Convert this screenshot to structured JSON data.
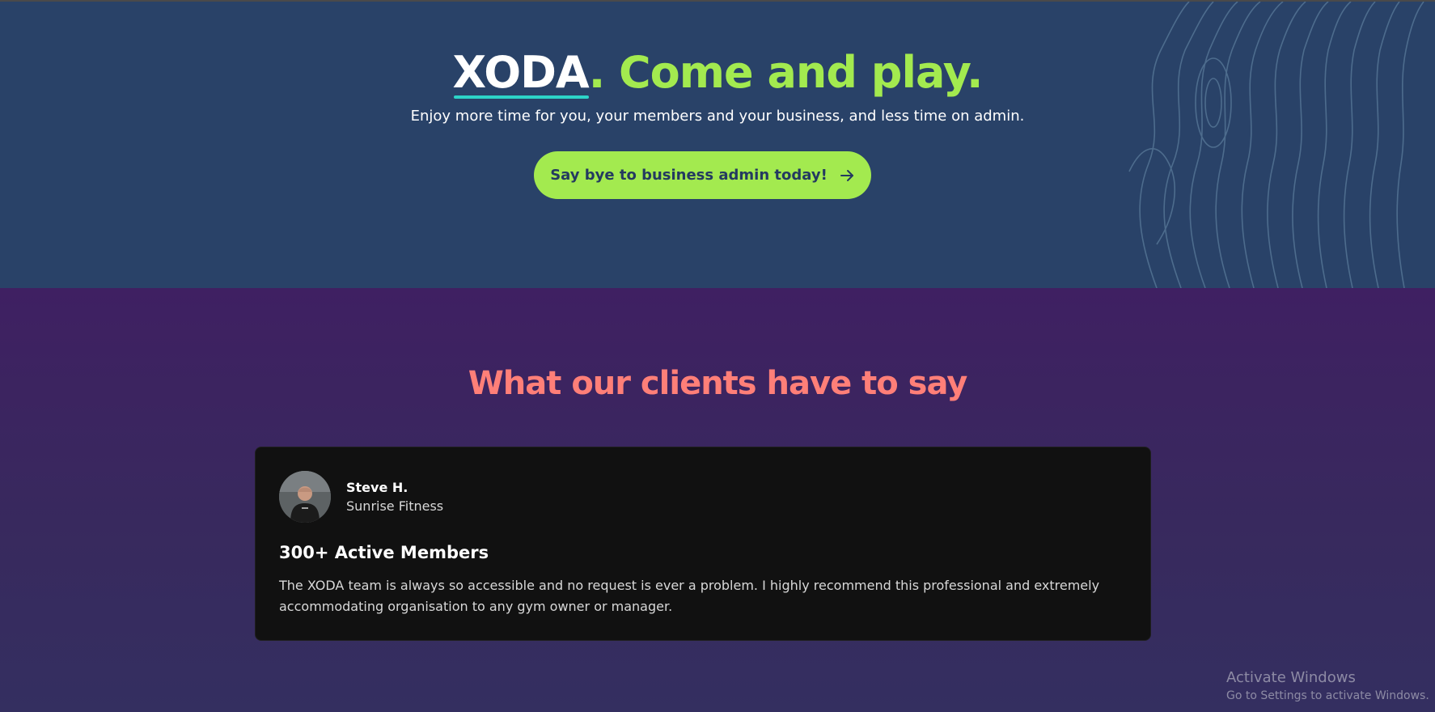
{
  "hero": {
    "brand": "XODA",
    "title_rest": ". Come and play.",
    "subtitle": "Enjoy more time for you, your members and your business, and less time on admin.",
    "cta_label": "Say bye to business admin today!",
    "cta_icon": "arrow-right-icon"
  },
  "testimonials": {
    "title": "What our clients have to say",
    "items": [
      {
        "name": "Steve H.",
        "company": "Sunrise Fitness",
        "heading": "300+ Active Members",
        "quote": "The XODA team is always so accessible and no request is ever a problem. I highly recommend this professional and extremely accommodating organisation to any gym owner or manager."
      }
    ]
  },
  "watermark": {
    "title": "Activate Windows",
    "subtitle": "Go to Settings to activate Windows."
  },
  "colors": {
    "hero_bg": "#294268",
    "accent_green": "#a3ea4f",
    "underline_teal": "#2dd4c8",
    "section_bg": "#3a2d62",
    "coral": "#ff7f78",
    "card_bg": "#111111"
  }
}
